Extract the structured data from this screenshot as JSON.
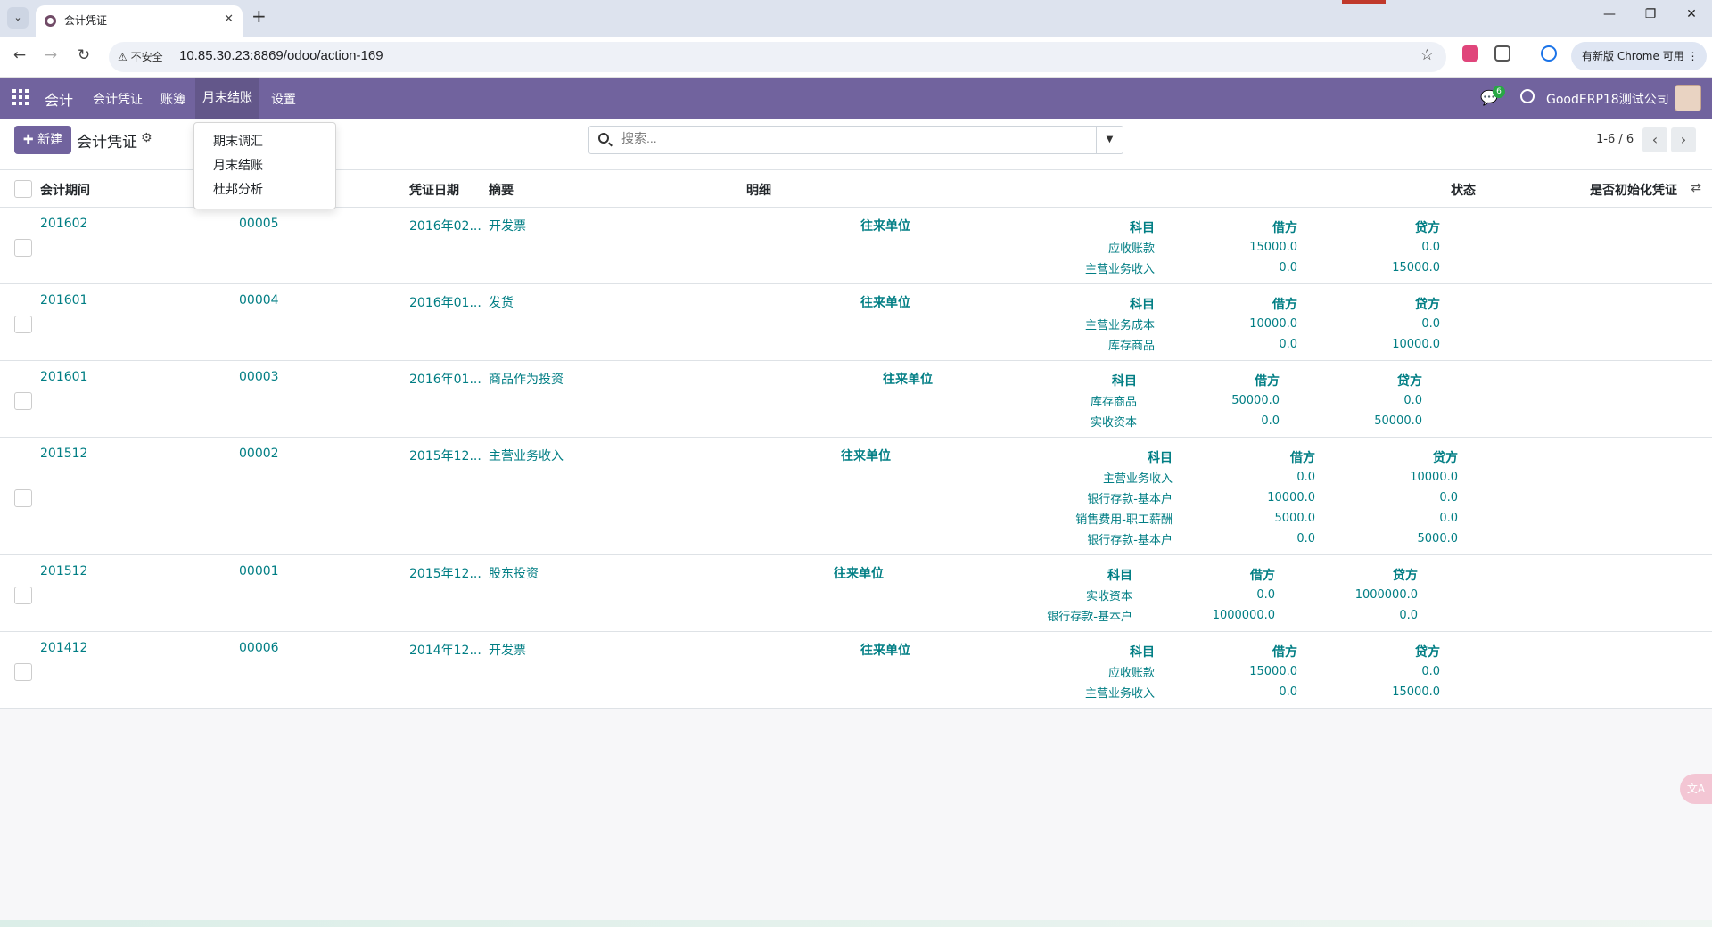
{
  "browser": {
    "tab_title": "会计凭证",
    "url": "10.85.30.23:8869/odoo/action-169",
    "insecure_label": "不安全",
    "update_label": "有新版 Chrome 可用"
  },
  "navbar": {
    "app_name": "会计",
    "menus": [
      "会计凭证",
      "账簿",
      "月末结账",
      "设置"
    ],
    "message_count": "6",
    "company": "GoodERP18测试公司"
  },
  "dropdown": {
    "items": [
      "期末调汇",
      "月末结账",
      "杜邦分析"
    ]
  },
  "control_panel": {
    "new_label": "新建",
    "title": "会计凭证",
    "search_placeholder": "搜索...",
    "pager": "1-6 / 6"
  },
  "list": {
    "columns": [
      "会计期间",
      "凭证日期",
      "摘要",
      "明细",
      "状态",
      "是否初始化凭证"
    ],
    "detail_headers": {
      "partner": "往来单位",
      "account": "科目",
      "debit": "借方",
      "credit": "贷方"
    },
    "rows": [
      {
        "period": "201602",
        "name": "00005",
        "date": "2016年02...",
        "summary": "开发票",
        "lines": [
          [
            "应收账款",
            "15000.0",
            "0.0"
          ],
          [
            "主营业务收入",
            "0.0",
            "15000.0"
          ]
        ]
      },
      {
        "period": "201601",
        "name": "00004",
        "date": "2016年01...",
        "summary": "发货",
        "lines": [
          [
            "主营业务成本",
            "10000.0",
            "0.0"
          ],
          [
            "库存商品",
            "0.0",
            "10000.0"
          ]
        ]
      },
      {
        "period": "201601",
        "name": "00003",
        "date": "2016年01...",
        "summary": "商品作为投资",
        "lines": [
          [
            "库存商品",
            "50000.0",
            "0.0"
          ],
          [
            "实收资本",
            "0.0",
            "50000.0"
          ]
        ]
      },
      {
        "period": "201512",
        "name": "00002",
        "date": "2015年12...",
        "summary": "主营业务收入",
        "lines": [
          [
            "主营业务收入",
            "0.0",
            "10000.0"
          ],
          [
            "银行存款-基本户",
            "10000.0",
            "0.0"
          ],
          [
            "销售费用-职工薪酬",
            "5000.0",
            "0.0"
          ],
          [
            "银行存款-基本户",
            "0.0",
            "5000.0"
          ]
        ]
      },
      {
        "period": "201512",
        "name": "00001",
        "date": "2015年12...",
        "summary": "股东投资",
        "lines": [
          [
            "实收资本",
            "0.0",
            "1000000.0"
          ],
          [
            "银行存款-基本户",
            "1000000.0",
            "0.0"
          ]
        ]
      },
      {
        "period": "201412",
        "name": "00006",
        "date": "2014年12...",
        "summary": "开发票",
        "lines": [
          [
            "应收账款",
            "15000.0",
            "0.0"
          ],
          [
            "主营业务收入",
            "0.0",
            "15000.0"
          ]
        ]
      }
    ]
  },
  "colors": {
    "brand": "#71639e",
    "link": "#017e84"
  }
}
